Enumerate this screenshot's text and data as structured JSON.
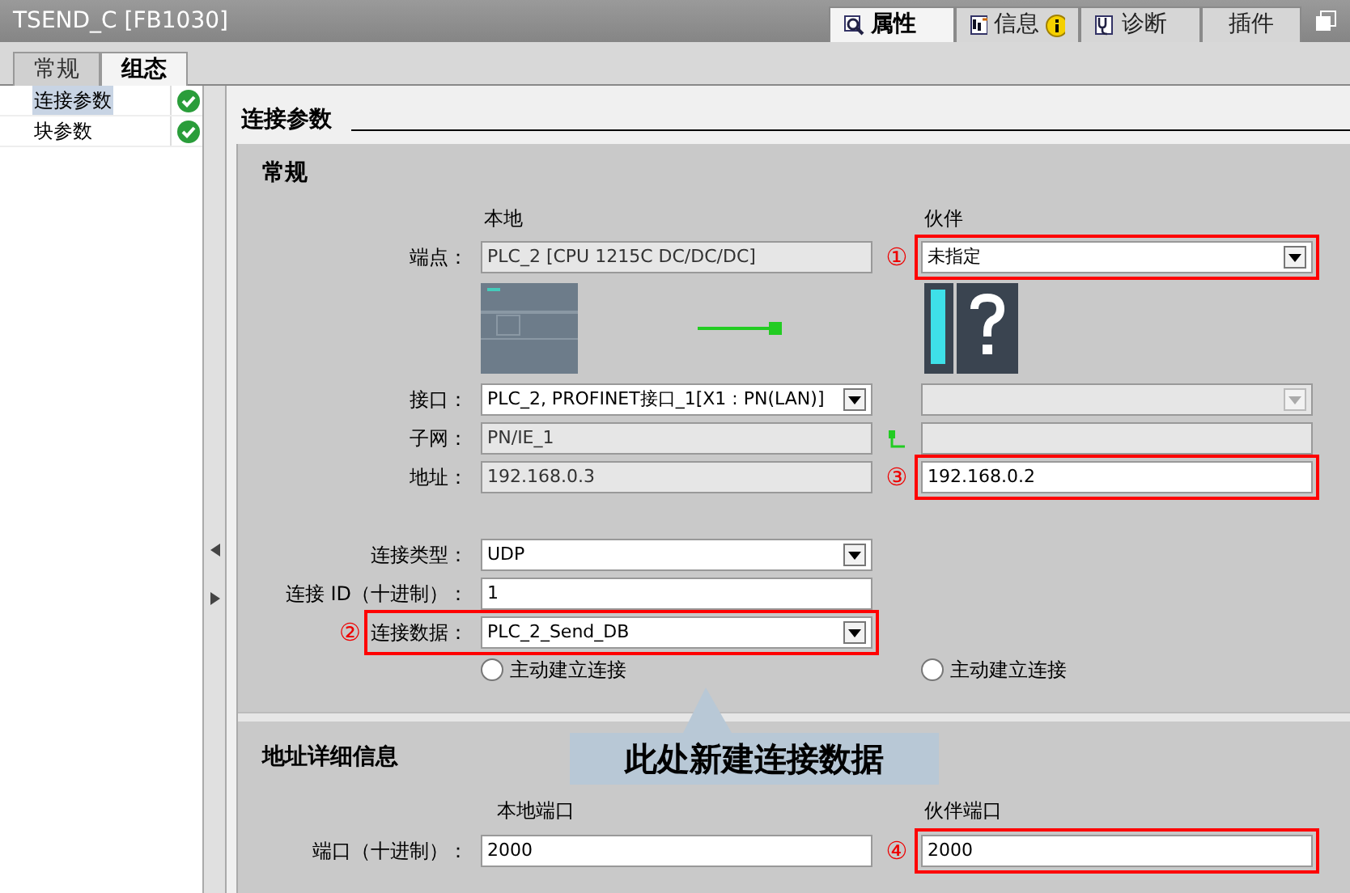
{
  "window": {
    "title": "TSEND_C [FB1030]"
  },
  "inspector_tabs": [
    {
      "label": "属性",
      "selected": true,
      "alert": false
    },
    {
      "label": "信息",
      "selected": false,
      "alert": true
    },
    {
      "label": "诊断",
      "selected": false,
      "alert": false
    },
    {
      "label": "插件",
      "selected": false,
      "alert": false
    }
  ],
  "tabs": [
    {
      "label": "常规",
      "selected": false
    },
    {
      "label": "组态",
      "selected": true
    }
  ],
  "sidebar": {
    "items": [
      {
        "label": "连接参数",
        "selected": true,
        "valid": true
      },
      {
        "label": "块参数",
        "selected": false,
        "valid": true
      }
    ]
  },
  "section_title": "连接参数",
  "general": {
    "title": "常规",
    "local_heading": "本地",
    "partner_heading": "伙伴",
    "rows": [
      {
        "label": "端点：",
        "local": {
          "value": "PLC_2 [CPU 1215C DC/DC/DC]",
          "kind": "readonly"
        },
        "partner": {
          "value": "未指定",
          "kind": "dropdown",
          "marker": "①"
        }
      },
      {
        "label": "接口：",
        "local": {
          "value": "PLC_2, PROFINET接口_1[X1 : PN(LAN)]",
          "kind": "dropdown"
        },
        "partner": {
          "kind": "dropdown",
          "disabled": true
        }
      },
      {
        "label": "子网：",
        "local": {
          "value": "PN/IE_1",
          "kind": "readonly"
        },
        "partner": {
          "kind": "readonly"
        },
        "link_icon": true
      },
      {
        "label": "地址：",
        "local": {
          "value": "192.168.0.3",
          "kind": "readonly"
        },
        "partner": {
          "value": "192.168.0.2",
          "kind": "input",
          "marker": "③"
        }
      }
    ],
    "connection_rows": [
      {
        "label": "连接类型：",
        "value": "UDP",
        "kind": "dropdown"
      },
      {
        "label": "连接 ID（十进制）：",
        "value": "1",
        "kind": "input"
      },
      {
        "label": "连接数据：",
        "value": "PLC_2_Send_DB",
        "kind": "dropdown",
        "marker": "②"
      }
    ],
    "radios": [
      {
        "label": "主动建立连接",
        "selected": false
      },
      {
        "label": "主动建立连接",
        "selected": false
      }
    ]
  },
  "callout": "此处新建连接数据",
  "address_details": {
    "title": "地址详细信息",
    "local_heading": "本地端口",
    "partner_heading": "伙伴端口",
    "label": "端口（十进制）：",
    "local": {
      "value": "2000",
      "kind": "input"
    },
    "partner": {
      "value": "2000",
      "kind": "input",
      "marker": "④"
    }
  }
}
